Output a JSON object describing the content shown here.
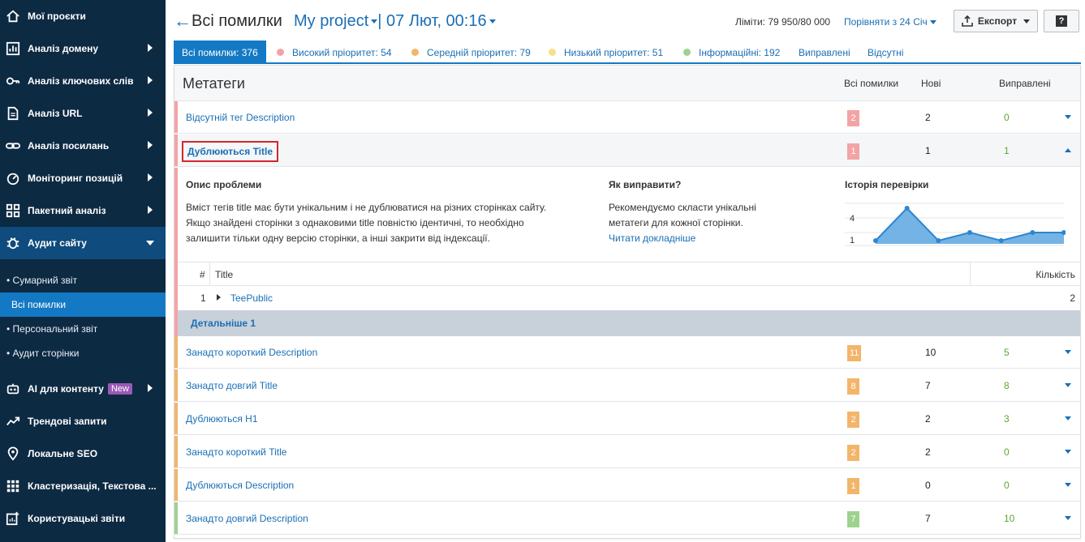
{
  "sidebar": {
    "items": [
      {
        "label": "Мої проєкти",
        "icon": "home-icon"
      },
      {
        "label": "Аналіз домену",
        "icon": "chart-icon"
      },
      {
        "label": "Аналіз ключових слів",
        "icon": "key-icon"
      },
      {
        "label": "Аналіз URL",
        "icon": "document-icon"
      },
      {
        "label": "Аналіз посилань",
        "icon": "link-icon"
      },
      {
        "label": "Моніторинг позицій",
        "icon": "speedometer-icon"
      },
      {
        "label": "Пакетний аналіз",
        "icon": "blocks-icon"
      },
      {
        "label": "Аудит сайту",
        "icon": "bug-icon"
      }
    ],
    "subitems": [
      "• Сумарний звіт",
      "Всі помилки",
      "• Персональний звіт",
      "• Аудит сторінки"
    ],
    "items2": [
      {
        "label": "AI для контенту",
        "icon": "robot-icon",
        "badge": "New"
      },
      {
        "label": "Трендові запити",
        "icon": "trend-icon"
      },
      {
        "label": "Локальне SEO",
        "icon": "pin-icon"
      },
      {
        "label": "Кластеризація, Текстова ...",
        "icon": "grid-icon"
      },
      {
        "label": "Користувацькі звіти",
        "icon": "custom-report-icon"
      }
    ]
  },
  "header": {
    "back": "←",
    "title": "Всі помилки",
    "project": "My project",
    "separator": "|",
    "date": "07 Лют, 00:16",
    "limits": "Ліміти: 79 950/80 000",
    "compare": "Порівняти з  24 Січ",
    "export": "Експорт",
    "help": "?"
  },
  "tabs": [
    {
      "label": "Всі помилки: 376"
    },
    {
      "label": "Високий пріоритет: 54",
      "color": "#f4a3a5"
    },
    {
      "label": "Середній пріоритет: 79",
      "color": "#f2b56b"
    },
    {
      "label": "Низький пріоритет: 51",
      "color": "#f7e08a"
    },
    {
      "label": "Інформаційні: 192",
      "color": "#9ed28f"
    },
    {
      "label": "Виправлені"
    },
    {
      "label": "Відсутні"
    }
  ],
  "panel": {
    "title": "Метатеги",
    "col_all": "Всі помилки",
    "col_new": "Нові",
    "col_fixed": "Виправлені"
  },
  "rows": [
    {
      "name": "Відсутній тег Description",
      "count": "2",
      "new": "2",
      "fixed": "0",
      "color": "#f4a3a5"
    },
    {
      "name": "Дублюються Title",
      "count": "1",
      "new": "1",
      "fixed": "1",
      "color": "#f4a3a5"
    },
    {
      "name": "Занадто короткий Description",
      "count": "11",
      "new": "10",
      "fixed": "5",
      "color": "#f2b56b"
    },
    {
      "name": "Занадто довгий Title",
      "count": "8",
      "new": "7",
      "fixed": "8",
      "color": "#f2b56b"
    },
    {
      "name": "Дублюються H1",
      "count": "2",
      "new": "2",
      "fixed": "3",
      "color": "#f2b56b"
    },
    {
      "name": "Занадто короткий Title",
      "count": "2",
      "new": "2",
      "fixed": "0",
      "color": "#f2b56b"
    },
    {
      "name": "Дублюються Description",
      "count": "1",
      "new": "0",
      "fixed": "0",
      "color": "#f2b56b"
    },
    {
      "name": "Занадто довгий Description",
      "count": "7",
      "new": "7",
      "fixed": "10",
      "color": "#9ed28f"
    }
  ],
  "expanded": {
    "problem_title": "Опис проблеми",
    "problem_l1": "Вміст тегів title має бути унікальним і не дублюватися на різних сторінках сайту.",
    "problem_l2": "Якщо знайдені сторінки з однаковими title повністю ідентичні, то необхідно",
    "problem_l3": "залишити тільки одну версію сторінки, а інші закрити від індексації.",
    "fix_title": "Як виправити?",
    "fix_l1": "Рекомендуємо скласти унікальні",
    "fix_l2": "метатеги для кожної сторінки.",
    "read_more": "Читати докладніше",
    "history_title": "Історія перевірки",
    "table_hash": "#",
    "table_title": "Title",
    "table_count": "Кількість",
    "table_row_num": "1",
    "table_row_name": "TeePublic",
    "table_row_count": "2",
    "details": "Детальніше 1"
  },
  "chart_data": {
    "type": "area",
    "x": [
      1,
      2,
      3,
      4,
      5,
      6,
      7
    ],
    "values": [
      1,
      5,
      1,
      2,
      1,
      2,
      2
    ],
    "ticks": [
      "4",
      "1"
    ],
    "color": "#2e86cf",
    "fill": "#5ca6e0"
  }
}
